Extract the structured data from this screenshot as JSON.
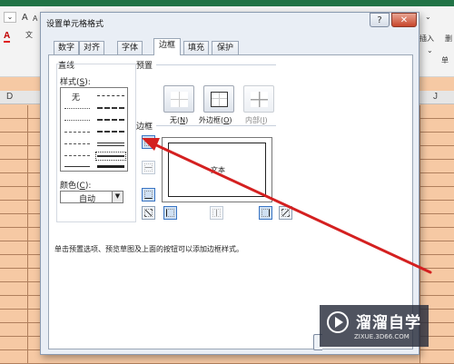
{
  "excel": {
    "ribbon_font_a": "A",
    "ribbon_font_a_small": "A",
    "ribbon_color_a": "A",
    "ribbon_wen": "文",
    "ribbon_insert": "插入",
    "ribbon_delete": "删",
    "ribbon_single": "单",
    "col_left": "D",
    "col_right": "J"
  },
  "dialog": {
    "title": "设置单元格格式",
    "help_label": "?",
    "close_label": "✕",
    "tabs": [
      "数字",
      "对齐",
      "字体",
      "边框",
      "填充",
      "保护"
    ],
    "active_tab": "边框",
    "line": {
      "group_label": "直线",
      "style_label": "样式(",
      "style_key": "S",
      "style_suffix": "):",
      "none_label": "无",
      "color_label": "颜色(",
      "color_key": "C",
      "color_suffix": "):",
      "color_value": "自动"
    },
    "presets": {
      "group_label": "预置",
      "none_label": "无(",
      "none_key": "N",
      "none_suffix": ")",
      "outline_label": "外边框(",
      "outline_key": "O",
      "outline_suffix": ")",
      "inside_label": "内部(",
      "inside_key": "I",
      "inside_suffix": ")"
    },
    "border": {
      "group_label": "边框",
      "preview_text": "文本"
    },
    "hint": "单击预置选项、预览草图及上面的按钮可以添加边框样式。"
  },
  "watermark": {
    "title": "溜溜自学",
    "url": "ZIXUE.3D66.COM"
  },
  "colors": {
    "excel_green": "#217346",
    "arrow_red": "#d42020",
    "sheet_fill": "#f6c9a4"
  }
}
